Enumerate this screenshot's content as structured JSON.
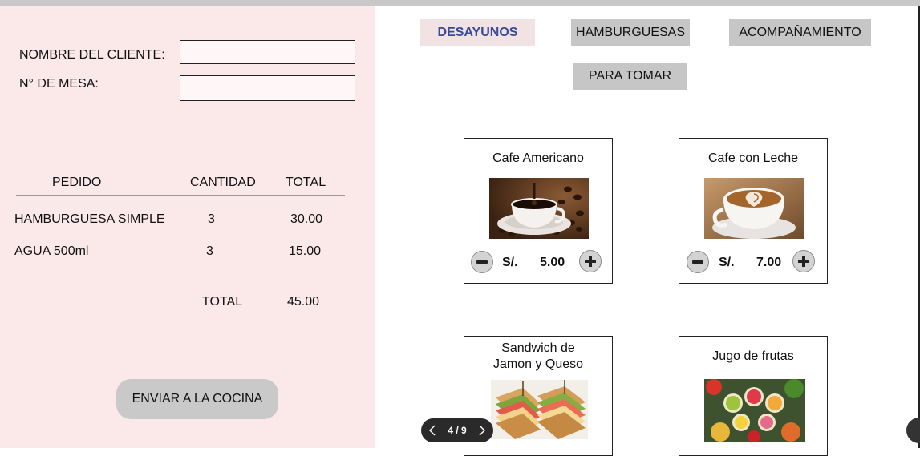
{
  "form": {
    "client_label": "NOMBRE DEL CLIENTE:",
    "client_value": "",
    "table_label": "N° DE MESA:",
    "table_value": ""
  },
  "order": {
    "headers": [
      "PEDIDO",
      "CANTIDAD",
      "TOTAL"
    ],
    "rows": [
      {
        "item": "HAMBURGUESA SIMPLE",
        "qty": "3",
        "total": "30.00"
      },
      {
        "item": "AGUA 500ml",
        "qty": "3",
        "total": "15.00"
      }
    ],
    "total_label": "TOTAL",
    "total_value": "45.00",
    "send_label": "ENVIAR A LA COCINA"
  },
  "tabs": [
    {
      "label": "DESAYUNOS",
      "active": true
    },
    {
      "label": "HAMBURGUESAS",
      "active": false
    },
    {
      "label": "ACOMPAÑAMIENTO",
      "active": false
    },
    {
      "label": "PARA TOMAR",
      "active": false
    }
  ],
  "products": [
    {
      "name": "Cafe Americano",
      "currency": "S/.",
      "price": "5.00",
      "image_icon": "black-coffee-cup-photo"
    },
    {
      "name": "Cafe con Leche",
      "currency": "S/.",
      "price": "7.00",
      "image_icon": "latte-art-cup-photo"
    },
    {
      "name": "Sandwich de Jamon y Queso",
      "name_line1": "Sandwich de",
      "name_line2": "Jamon y Queso",
      "image_icon": "club-sandwich-photo"
    },
    {
      "name": "Jugo de frutas",
      "image_icon": "fruit-juice-photo"
    }
  ],
  "pager": {
    "label": "4 / 9"
  },
  "colors": {
    "left_panel": "#fbe9ea",
    "active_tab_bg": "#f1e3e4",
    "active_tab_text": "#3a4a98",
    "tab_bg": "#c6c6c6",
    "send_button": "#c9c9c9"
  }
}
